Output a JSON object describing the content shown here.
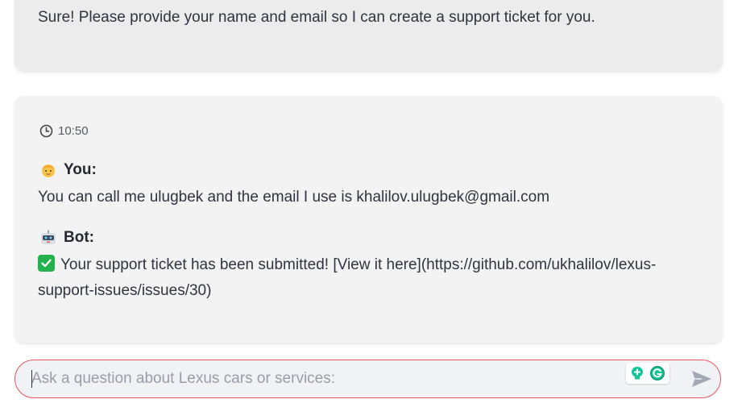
{
  "previous_message": {
    "text": "Sure! Please provide your name and email so I can create a support ticket for you."
  },
  "current_exchange": {
    "time_icon": "clock-icon",
    "time": "10:50",
    "user_avatar": "person-emoji-icon",
    "user_label": "You:",
    "user_message": "You can call me ulugbek and the email I use is khalilov.ulugbek@gmail.com",
    "bot_avatar": "robot-emoji-icon",
    "bot_label": "Bot:",
    "bot_status_icon": "check-mark-button-icon",
    "bot_message_line1": "Your support ticket has been submitted! [View it here](https://github.com/ukhalilov/lexus-",
    "bot_message_line2": "support-issues/issues/30)"
  },
  "chat_input": {
    "value": "",
    "placeholder": "Ask a question about Lexus cars or services:",
    "border_color": "#e8545c",
    "extension_icons": [
      "grammarly-plus-icon",
      "grammarly-g-icon"
    ],
    "send_icon": "send-arrow-icon"
  },
  "colors": {
    "card_background": "#f3f3f3",
    "text": "#31333f",
    "check_green": "#22b14c",
    "grammarly_green": "#15c39a"
  }
}
